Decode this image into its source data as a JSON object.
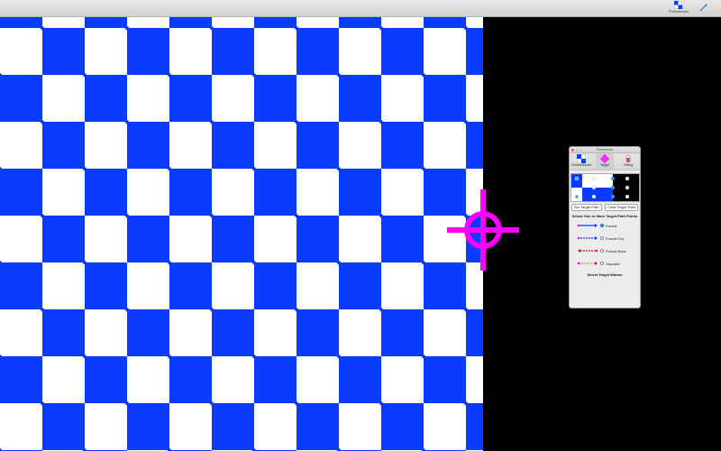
{
  "menubar": {
    "preferences_label": "Preferences",
    "preferences_icon": "checkerboard-icon",
    "crosshair_toggle_icon": "pen-icon"
  },
  "stage": {
    "pattern_colors": {
      "dark": "#0a3cff",
      "light": "#ffffff"
    },
    "background_color": "#000000",
    "reticle_color": "#ff00ff"
  },
  "preferences_panel": {
    "title": "Preferences",
    "tabs": [
      {
        "label": "Checkerboard",
        "icon": "checkerboard-icon"
      },
      {
        "label": "Target",
        "icon": "target-icon",
        "selected": true
      },
      {
        "label": "Timing",
        "icon": "timing-icon"
      }
    ],
    "path_buttons": {
      "set": "Set Target Path",
      "clear": "Clear Target Path"
    },
    "points_heading": "Select One or More Target Path Points",
    "motions": [
      {
        "label": "Pursuit",
        "selected": true
      },
      {
        "label": "Pursuit Out",
        "selected": false
      },
      {
        "label": "Pursuit Back",
        "selected": false
      },
      {
        "label": "Saccade",
        "selected": false
      }
    ],
    "motion_heading": "Select Target Motion"
  }
}
